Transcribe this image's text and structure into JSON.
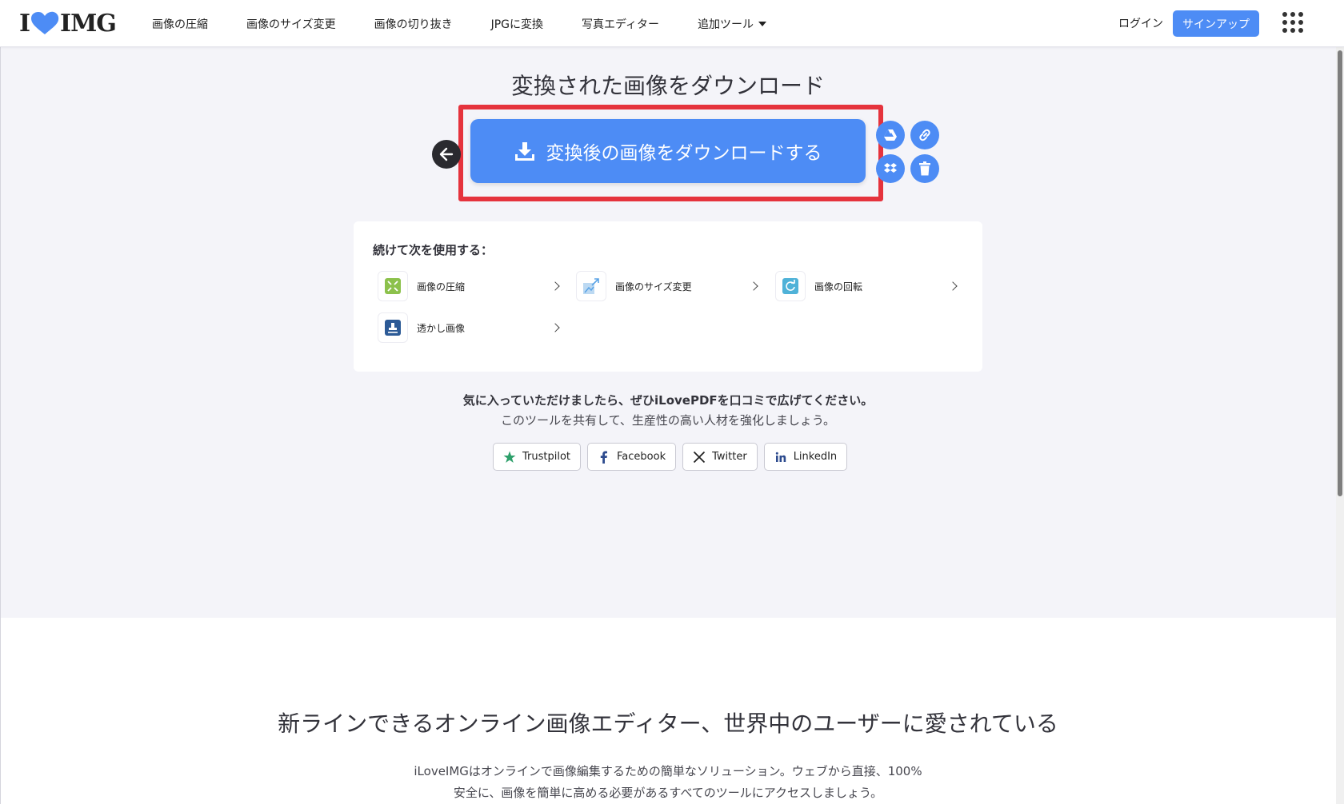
{
  "header": {
    "logo_left": "I",
    "logo_right": "IMG",
    "nav": [
      {
        "label": "画像の圧縮"
      },
      {
        "label": "画像のサイズ変更"
      },
      {
        "label": "画像の切り抜き"
      },
      {
        "label": "JPGに変換"
      },
      {
        "label": "写真エディター"
      },
      {
        "label": "追加ツール"
      }
    ],
    "login": "ログイン",
    "signup": "サインアップ"
  },
  "download": {
    "title": "変換された画像をダウンロード",
    "button_label": "変換後の画像をダウンロードする"
  },
  "continue": {
    "title": "続けて次を使用する：",
    "tools": [
      {
        "label": "画像の圧縮",
        "color": "#8cc14c"
      },
      {
        "label": "画像のサイズ変更",
        "color": "#5ba4e6"
      },
      {
        "label": "画像の回転",
        "color": "#4fb2d8"
      },
      {
        "label": "透かし画像",
        "color": "#2c5a96"
      }
    ]
  },
  "share": {
    "bold": "気に入っていただけましたら、ぜひiLovePDFを口コミで広げてください。",
    "sub": "このツールを共有して、生産性の高い人材を強化しましょう。",
    "buttons": [
      {
        "label": "Trustpilot",
        "icon": "star-icon"
      },
      {
        "label": "Facebook",
        "icon": "facebook-icon"
      },
      {
        "label": "Twitter",
        "icon": "x-icon"
      },
      {
        "label": "LinkedIn",
        "icon": "linkedin-icon"
      }
    ]
  },
  "bottom": {
    "title": "新ラインできるオンライン画像エディター、世界中のユーザーに愛されている",
    "desc_line1": "iLoveIMGはオンラインで画像編集するための簡単なソリューション。ウェブから直接、100%",
    "desc_line2": "安全に、画像を簡単に高める必要があるすべてのツールにアクセスしましょう。"
  },
  "colors": {
    "accent": "#4d8cf5",
    "highlight": "#e5333d",
    "background": "#f4f4f9"
  }
}
